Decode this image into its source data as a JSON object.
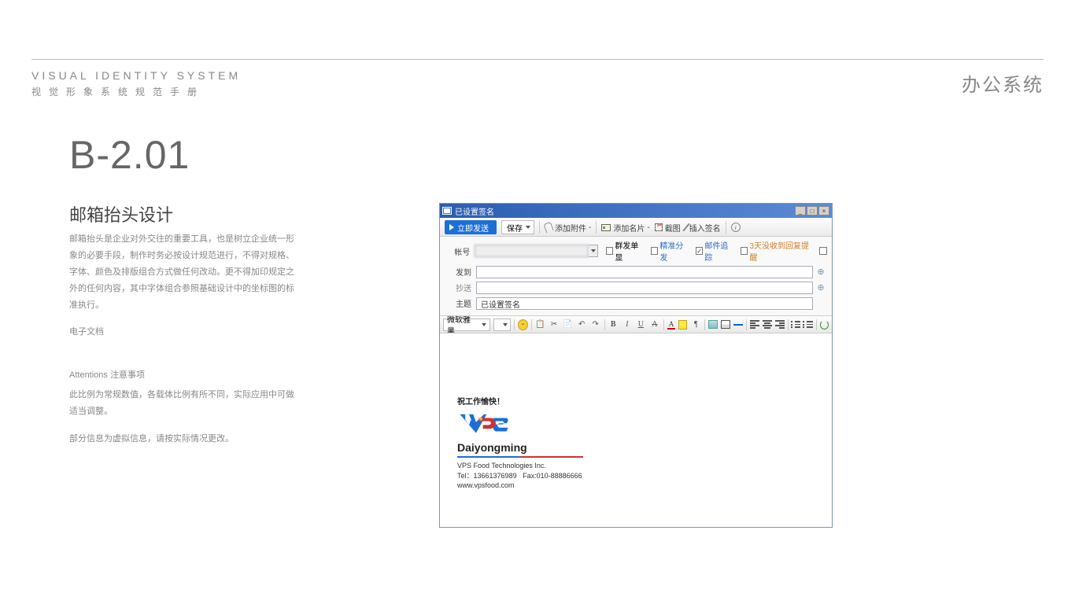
{
  "header": {
    "title_en": "VISUAL IDENTITY SYSTEM",
    "title_cn": "视觉形象系统规范手册",
    "category": "办公系统"
  },
  "section": {
    "code": "B-2.01",
    "title": "邮箱抬头设计",
    "desc": "邮箱抬头是企业对外交往的重要工具，也是树立企业统一形象的必要手段，制作时务必按设计规范进行，不得对规格、字体、颜色及排版组合方式做任何改动。更不得加印规定之外的任何内容，其中字体组合参照基础设计中的坐标图的标准执行。",
    "sub_label": "电子文档",
    "note_title": "Attentions 注意事项",
    "note1": "此比例为常规数值，各载体比例有所不同，实际应用中可做适当调整。",
    "note2": "部分信息为虚拟信息，请按实际情况更改。"
  },
  "mail": {
    "titlebar": "已设置签名",
    "send": "立即发送",
    "save": "保存",
    "attach": "添加附件",
    "addname": "添加名片",
    "screenshot": "截图",
    "insertsig": "插入签名",
    "field_account": "帐号",
    "field_to": "发到",
    "field_cc": "抄送",
    "field_subject": "主题",
    "subject_value": "已设置签名",
    "chk1": "群发单显",
    "chk2": "精准分发",
    "chk3": "邮件追踪",
    "chk4": "3天没收到回复提醒",
    "font": "微软雅黑"
  },
  "sig": {
    "greeting": "祝工作愉快！",
    "name": "Daiyongming",
    "company": "VPS Food Technologies Inc.",
    "tel_label": "Tel：",
    "tel": "13661376989",
    "fax_label": "Fax:",
    "fax": "010-88886666",
    "web": "www.vpsfood.com"
  }
}
